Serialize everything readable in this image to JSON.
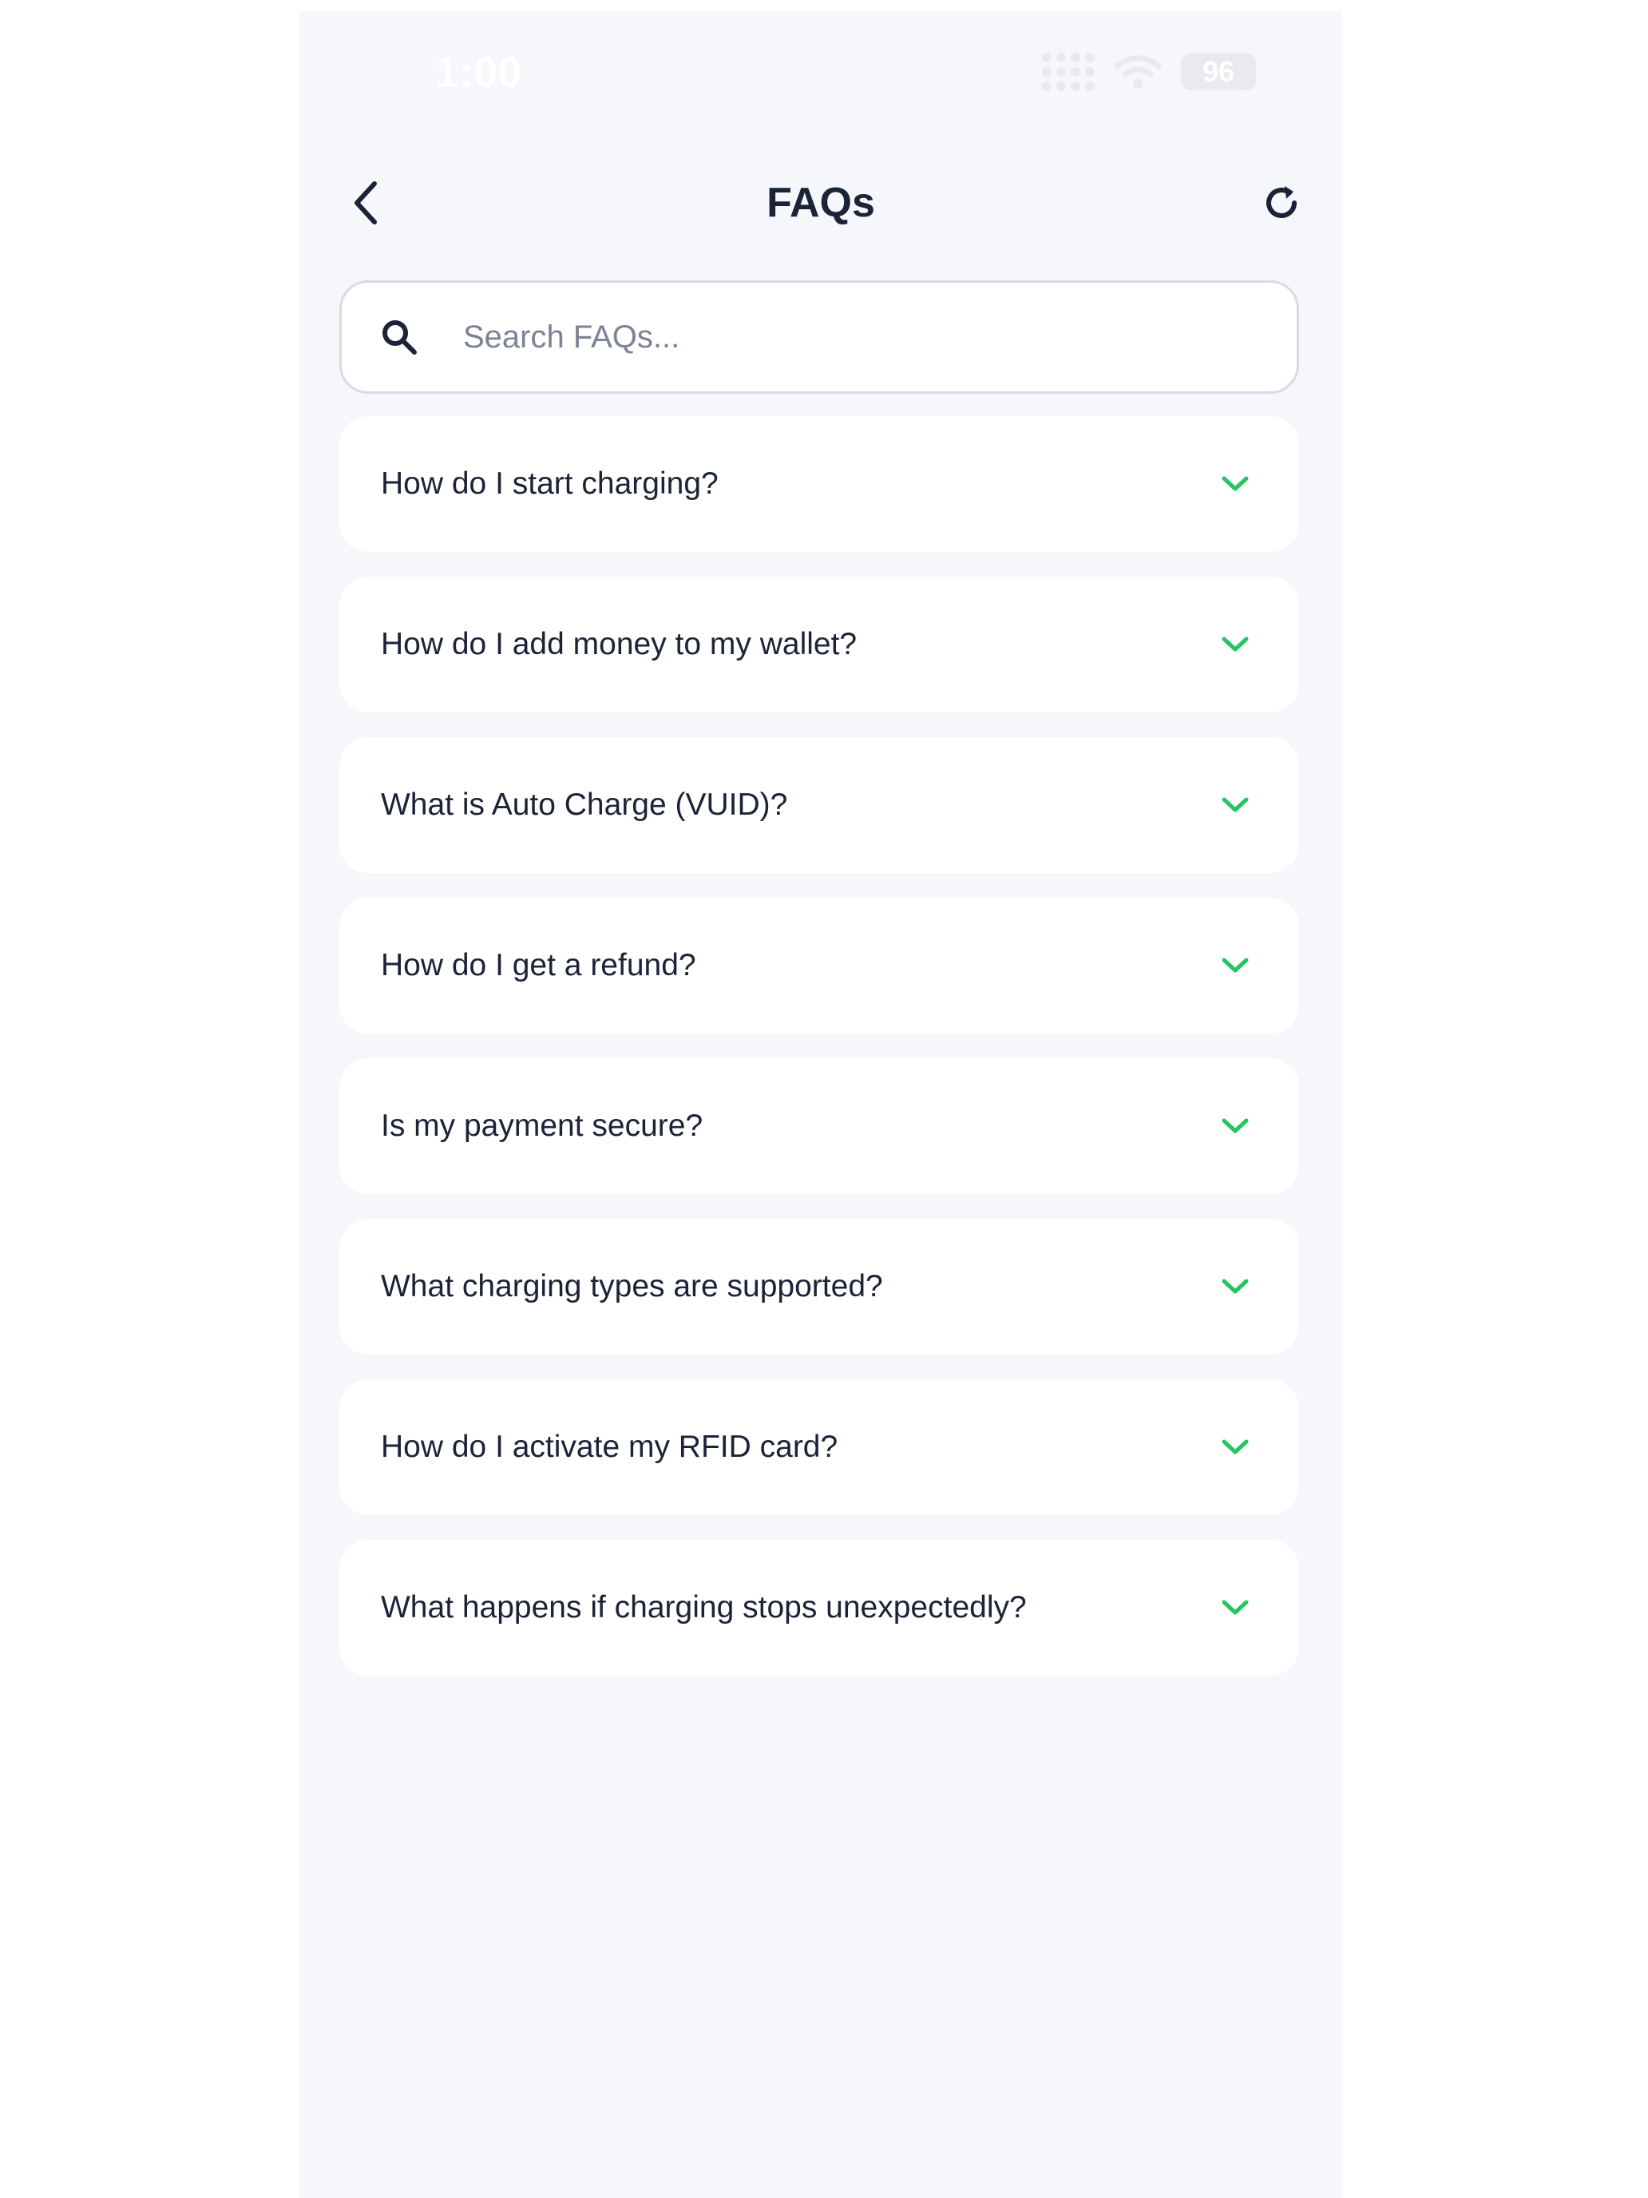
{
  "status_bar": {
    "time": "1:00",
    "battery": "96",
    "icons": [
      "signal-icon",
      "wifi-icon",
      "battery-icon"
    ]
  },
  "header": {
    "title": "FAQs",
    "back_icon": "chevron-left-icon",
    "refresh_icon": "refresh-icon"
  },
  "search": {
    "placeholder": "Search FAQs...",
    "value": "",
    "icon": "search-icon"
  },
  "faqs": [
    {
      "question": "How do I start charging?"
    },
    {
      "question": "How do I add money to my wallet?"
    },
    {
      "question": "What is Auto Charge (VUID)?"
    },
    {
      "question": "How do I get a refund?"
    },
    {
      "question": "Is my payment secure?"
    },
    {
      "question": "What charging types are supported?"
    },
    {
      "question": "How do I activate my RFID card?"
    },
    {
      "question": "What happens if charging stops unexpectedly?"
    }
  ],
  "colors": {
    "background": "#f6f7fb",
    "card": "#ffffff",
    "text": "#1b2337",
    "accent": "#22c55e",
    "placeholder": "#7b8394",
    "border": "#d8dbe4"
  }
}
